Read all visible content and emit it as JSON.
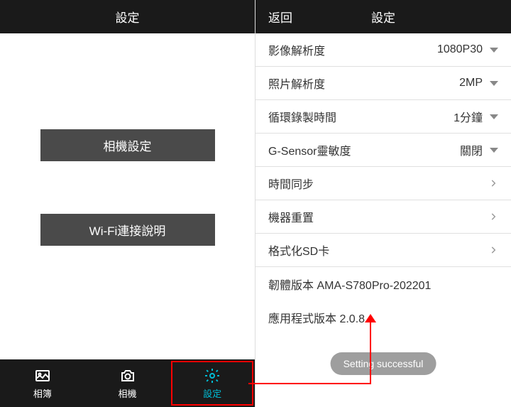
{
  "left": {
    "title": "設定",
    "buttons": {
      "camera_settings": "相機設定",
      "wifi_help": "Wi-Fi連接說明"
    },
    "tabs": {
      "album": "相簿",
      "camera": "相機",
      "settings": "設定"
    }
  },
  "right": {
    "back": "返回",
    "title": "設定",
    "rows": {
      "video_res_label": "影像解析度",
      "video_res_value": "1080P30",
      "photo_res_label": "照片解析度",
      "photo_res_value": "2MP",
      "loop_label": "循環錄製時間",
      "loop_value": "1分鐘",
      "gsensor_label": "G-Sensor靈敏度",
      "gsensor_value": "關閉",
      "time_sync": "時間同步",
      "reset": "機器重置",
      "format_sd": "格式化SD卡",
      "firmware": "韌體版本 AMA-S780Pro-202201",
      "app_version": "應用程式版本 2.0.8"
    },
    "toast": "Setting successful"
  }
}
